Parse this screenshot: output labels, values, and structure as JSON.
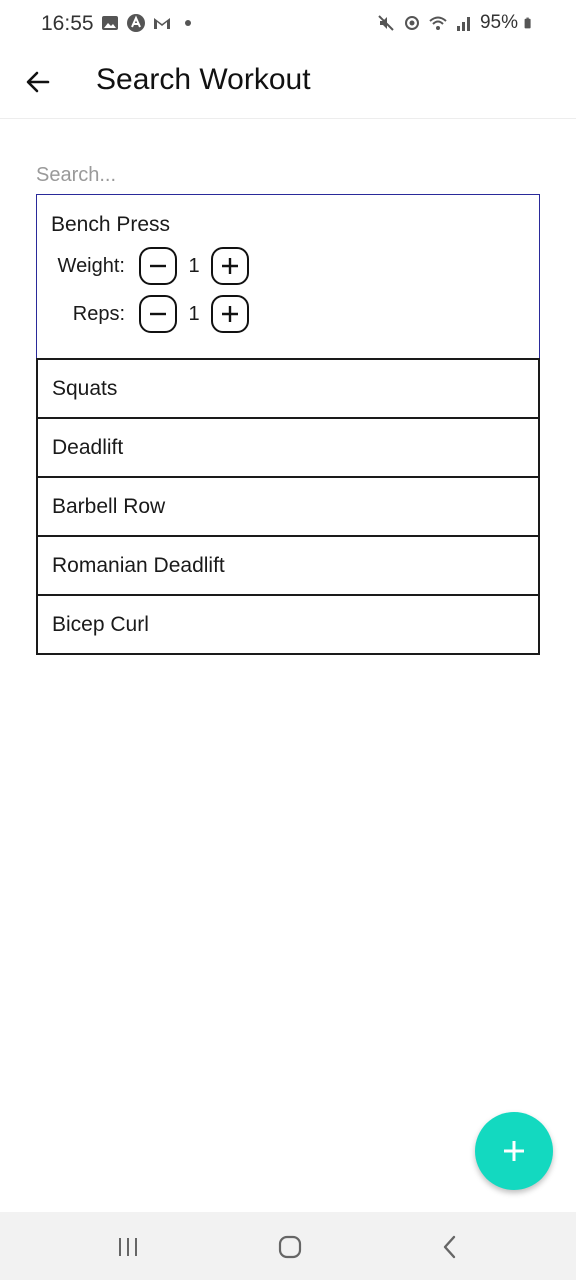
{
  "status": {
    "time": "16:55",
    "battery_text": "95%"
  },
  "header": {
    "title": "Search Workout",
    "back_icon": "arrow-left-icon"
  },
  "search": {
    "placeholder": "Search...",
    "value": ""
  },
  "exercises": [
    {
      "name": "Bench Press",
      "weight_label": "Weight:",
      "weight_value": "1",
      "reps_label": "Reps:",
      "reps_value": "1"
    },
    {
      "name": "Squats"
    },
    {
      "name": "Deadlift"
    },
    {
      "name": "Barbell Row"
    },
    {
      "name": "Romanian Deadlift"
    },
    {
      "name": "Bicep Curl"
    }
  ],
  "colors": {
    "fab": "#13d9c0",
    "selected_border": "#2a2a9a",
    "item_border": "#1a1a1a"
  },
  "fab_icon": "plus-icon"
}
